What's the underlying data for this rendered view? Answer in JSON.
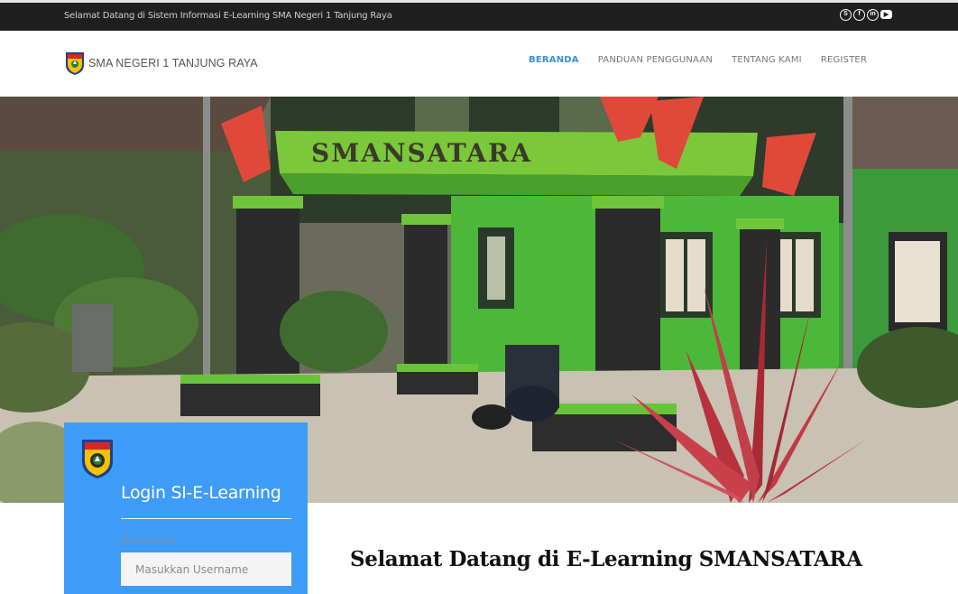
{
  "topbar": {
    "welcome_text": "Selamat Datang di Sistem Informasi E-Learning SMA Negeri 1 Tanjung Raya",
    "socials": [
      {
        "icon": "skype-icon",
        "glyph": "S"
      },
      {
        "icon": "facebook-icon",
        "glyph": "f"
      },
      {
        "icon": "linkedin-icon",
        "glyph": "in"
      },
      {
        "icon": "youtube-icon",
        "glyph": "▶"
      }
    ]
  },
  "navbar": {
    "brand_name": "SMA NEGERI 1 TANJUNG RAYA",
    "menu": [
      {
        "label": "BERANDA",
        "active": true
      },
      {
        "label": "PANDUAN PENGGUNAAN",
        "active": false
      },
      {
        "label": "TENTANG KAMI",
        "active": false
      },
      {
        "label": "REGISTER",
        "active": false
      }
    ]
  },
  "hero": {
    "sign_text": "SMANSATARA",
    "slides": 3,
    "active_slide": 2
  },
  "login": {
    "title": "Login SI-E-Learning",
    "username_label": "Username",
    "username_placeholder": "Masukkan Username",
    "username_value": ""
  },
  "content": {
    "heading": "Selamat Datang di E-Learning SMANSATARA"
  },
  "colors": {
    "accent": "#3d9cf7",
    "active_menu": "#3a8fd8",
    "topbar_bg": "#1f1f1f"
  }
}
